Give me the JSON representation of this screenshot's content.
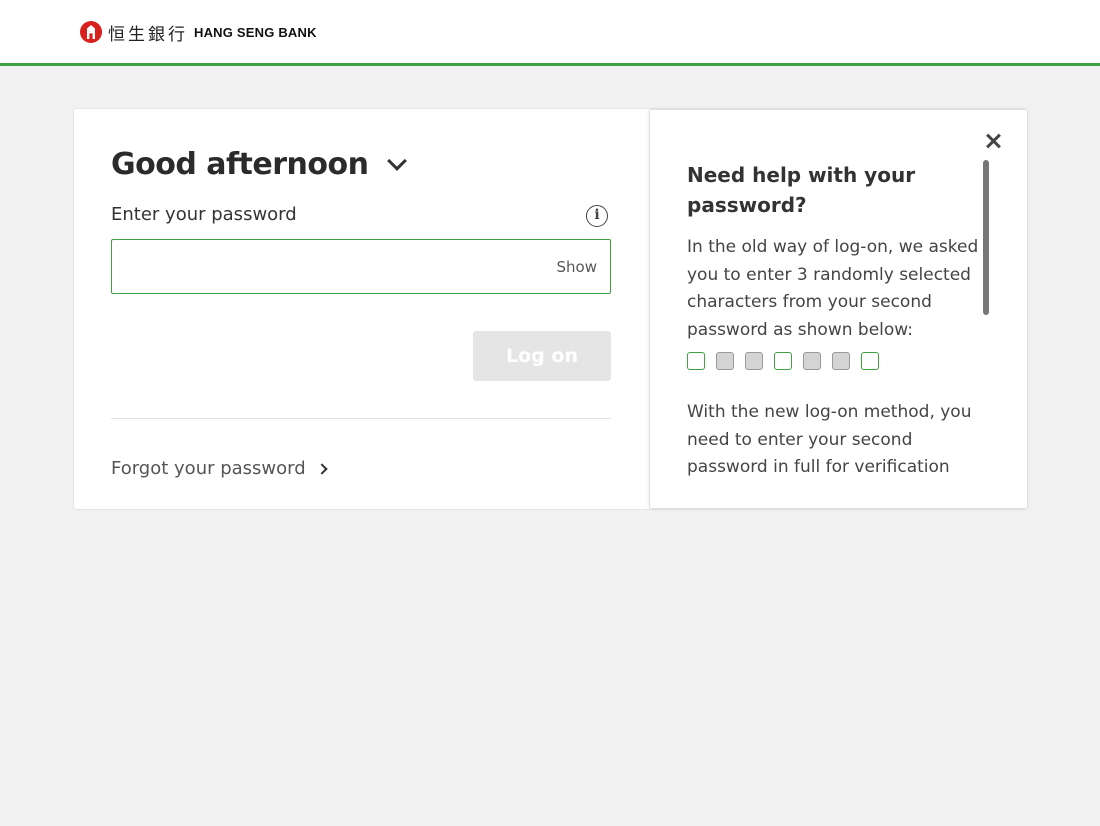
{
  "header": {
    "logo_cn": "恒生銀行",
    "logo_en": "HANG SENG BANK",
    "accent_color": "#3fa142",
    "logo_color": "#d8201c"
  },
  "login": {
    "greeting": "Good afternoon",
    "password_label": "Enter your password",
    "password_value": "",
    "show_label": "Show",
    "logon_label": "Log on",
    "forgot_label": "Forgot your password",
    "icons": [
      "chevron-down-icon",
      "info-icon",
      "chevron-right-icon"
    ]
  },
  "help_panel": {
    "title": "Need help with your password?",
    "para1": "In the old way of log-on, we asked you to enter 3 randomly selected characters from your second password as shown below:",
    "boxes": [
      "selected",
      "masked",
      "masked",
      "selected",
      "masked",
      "masked",
      "selected"
    ],
    "para2": "With the new log-on method, you need to enter your second password in full for verification",
    "icons": [
      "close-icon"
    ]
  }
}
